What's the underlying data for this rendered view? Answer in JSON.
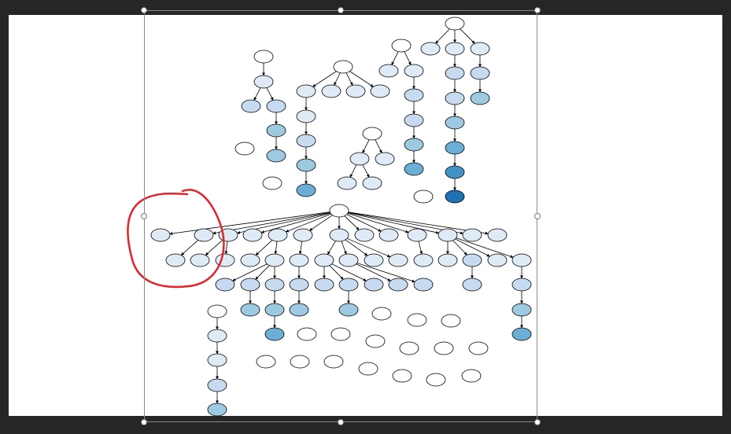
{
  "canvas": {
    "background": "#ffffff",
    "window_background": "#262626"
  },
  "selection": {
    "frame_color": "#8a8a8a",
    "handle_color": "#ffffff"
  },
  "annotation": {
    "type": "freehand-circle",
    "color": "#e0242b"
  },
  "graph": {
    "node_colors": [
      "#ffffff",
      "#deebf7",
      "#c6dbef",
      "#9ecae1",
      "#6baed6",
      "#4292c6",
      "#2171b5"
    ],
    "edge_color": "#000000",
    "node_stroke": "#000000"
  }
}
